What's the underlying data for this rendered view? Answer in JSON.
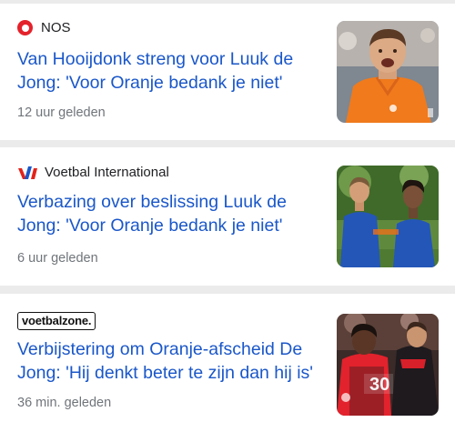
{
  "articles": [
    {
      "source": "NOS",
      "source_icon": "nos-logo-icon",
      "headline": "Van Hooijdonk streng voor Luuk de Jong: 'Voor Oranje bedank je niet'",
      "time": "12 uur geleden"
    },
    {
      "source": "Voetbal International",
      "source_icon": "vi-logo-icon",
      "headline": "Verbazing over beslissing Luuk de Jong: 'Voor Oranje bedank je niet'",
      "time": "6 uur geleden"
    },
    {
      "source": "voetbalzone.",
      "source_icon": "voetbalzone-logo",
      "headline": "Verbijstering om Oranje-afscheid De Jong: 'Hij denkt beter te zijn dan hij is'",
      "time": "36 min. geleden"
    }
  ],
  "colors": {
    "headline": "#1a57c9",
    "meta": "#70757a",
    "nos_red": "#e4222b",
    "vi_red": "#e2231a",
    "vi_blue": "#1a57c9",
    "oranje": "#f07a1c",
    "dutch_away_blue": "#2456b8"
  }
}
